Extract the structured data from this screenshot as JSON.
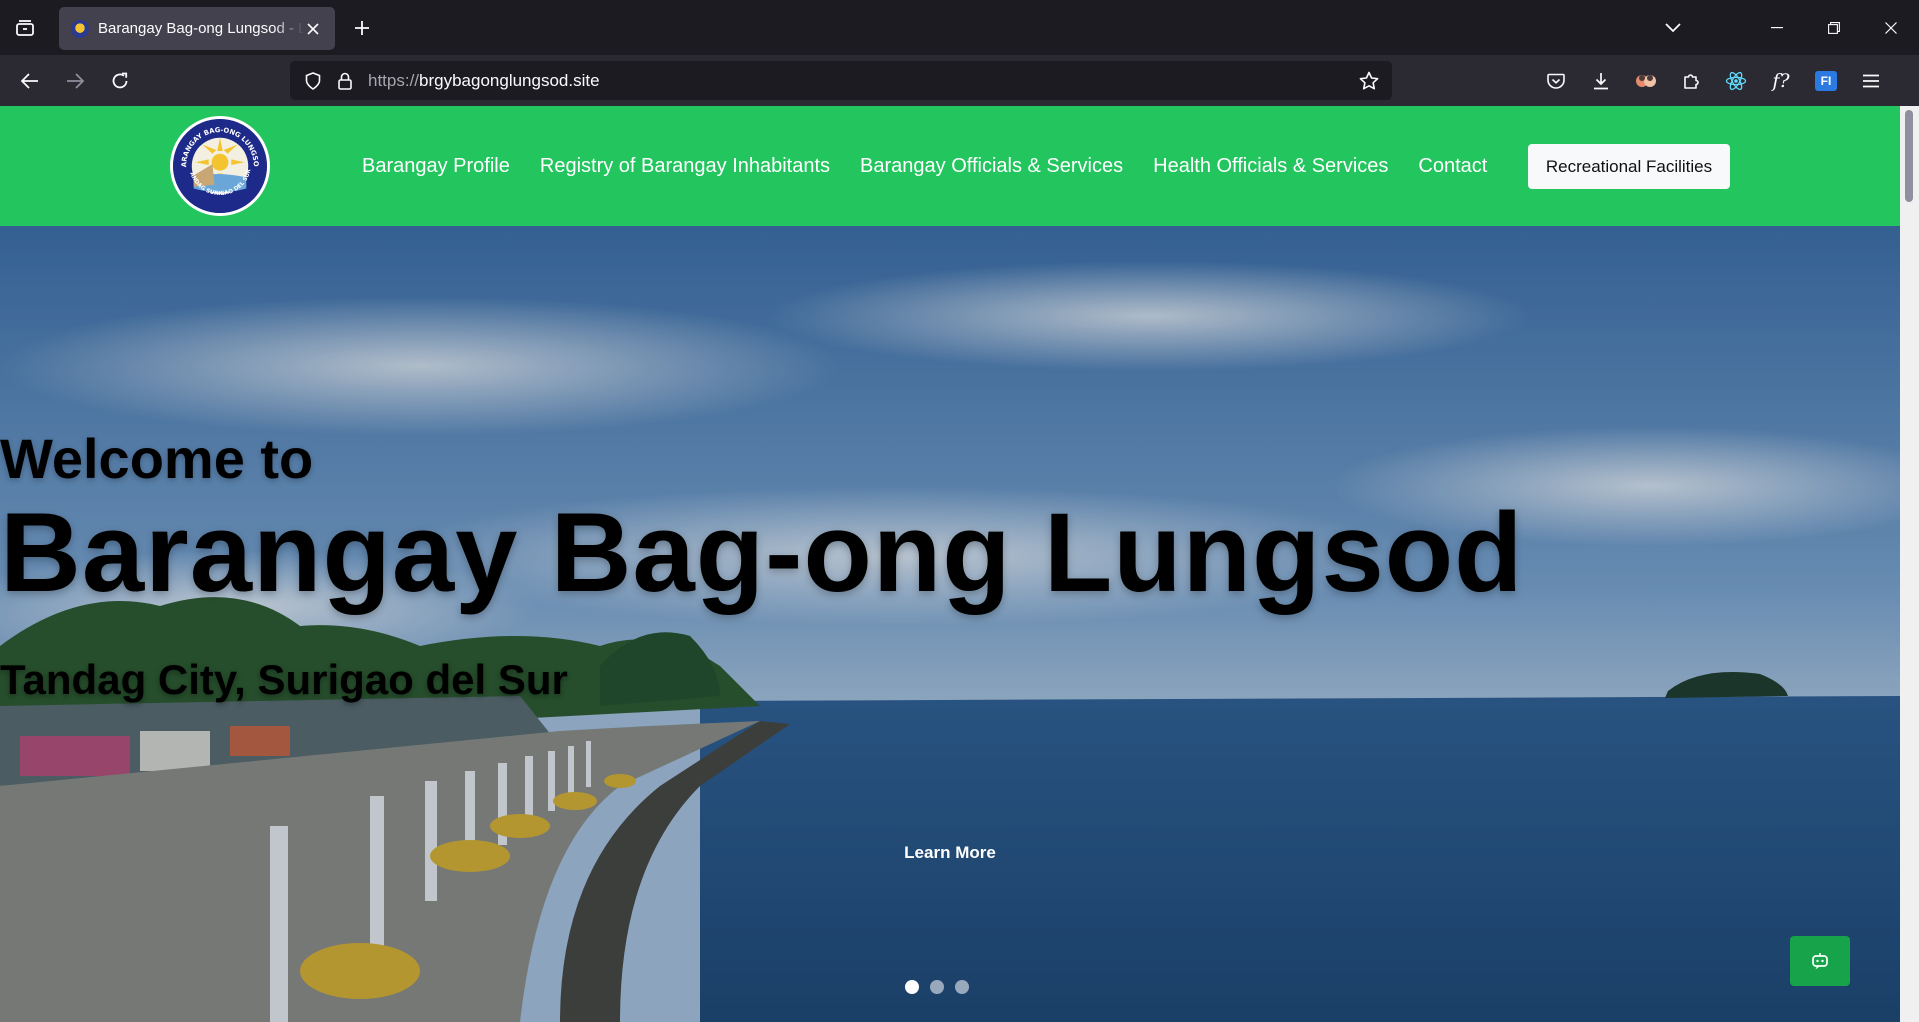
{
  "browser": {
    "tab": {
      "title": "Barangay Bag-ong Lungsod - Lungsod"
    },
    "url": {
      "protocol": "https://",
      "host": "brgybagonglungsod.site"
    },
    "toolbar_icons": [
      "pocket-icon",
      "download-icon",
      "profile-icon",
      "extensions-icon",
      "react-devtools-icon",
      "font-finder-icon",
      "fi-extension-icon",
      "app-menu-icon"
    ],
    "font_finder_label": "f?",
    "fi_label": "FI"
  },
  "site": {
    "logo": {
      "text_top": "BARANGAY BAG-ONG LUNGSOD",
      "text_bottom": "TANDAG SURIGAO DEL SUR"
    },
    "nav": [
      {
        "label": "Barangay Profile"
      },
      {
        "label": "Registry of Barangay Inhabitants"
      },
      {
        "label": "Barangay Officials & Services"
      },
      {
        "label": "Health Officials & Services"
      },
      {
        "label": "Contact"
      }
    ],
    "cta": "Recreational Facilities",
    "accent": "#22c55e"
  },
  "hero": {
    "welcome": "Welcome to",
    "title": "Barangay Bag-ong Lungsod",
    "subtitle": "Tandag City, Surigao del Sur",
    "learn_more": "Learn More",
    "slides": 3,
    "active_slide": 1
  }
}
